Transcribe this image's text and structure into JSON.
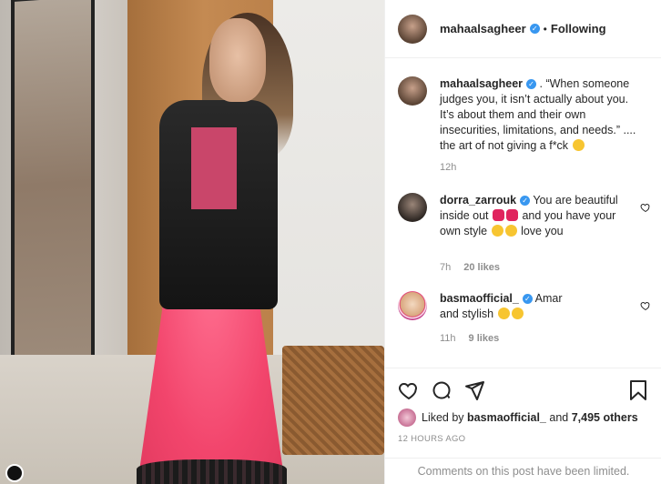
{
  "post": {
    "author": "mahaalsagheer",
    "separator": "•",
    "follow_status": "Following"
  },
  "caption": {
    "author": "mahaalsagheer",
    "text": ". “When someone judges you, it isn’t actually about you. It’s about them and their own insecurities, limitations, and needs.” .... the art of not giving a f*ck",
    "time": "12h"
  },
  "comments": [
    {
      "author": "dorra_zarrouk",
      "text_a": "You are beautiful inside out",
      "text_b": "and you have your own style",
      "text_c": "love you",
      "time": "7h",
      "likes": "20 likes"
    },
    {
      "author": "basmaofficial_",
      "text_a": "Amar and stylish",
      "time": "11h",
      "likes": "9 likes"
    }
  ],
  "likes": {
    "prefix": "Liked by",
    "user": "basmaofficial_",
    "middle": "and",
    "count": "7,495 others"
  },
  "timestamp": "12 HOURS AGO",
  "limited_notice": "Comments on this post have been limited.",
  "colors": {
    "accent_blue": "#3897f0",
    "heart_red": "#ed4956",
    "muted": "#8e8e8e"
  },
  "icons": [
    "heart-icon",
    "comment-icon",
    "share-icon",
    "bookmark-icon",
    "verified-icon"
  ]
}
